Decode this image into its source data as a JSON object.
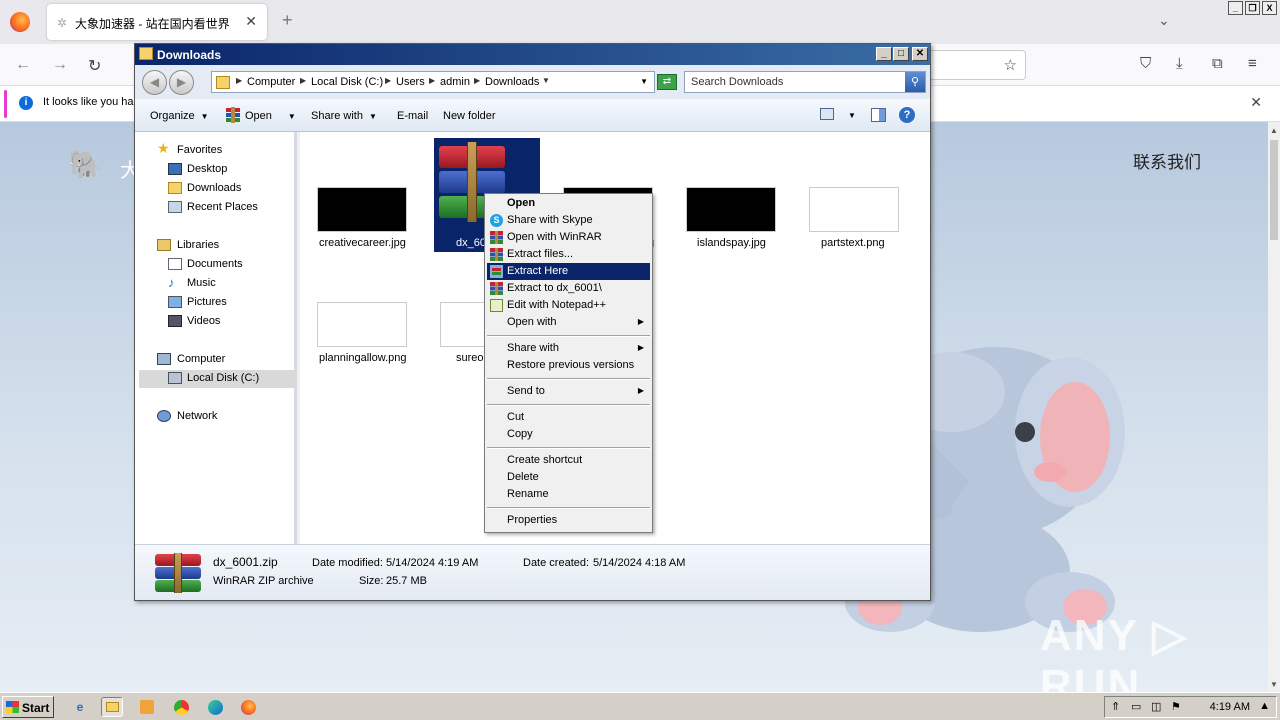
{
  "browser": {
    "tab_title": "大象加速器 - 站在国内看世界",
    "tab_close": "✕",
    "new_tab": "+",
    "tab_list": "⌄",
    "back": "←",
    "forward": "→",
    "reload": "↻",
    "notice_text": "It looks like you ha",
    "notice_close": "✕",
    "window_min": "_",
    "window_restore": "❐",
    "window_close": "X"
  },
  "webpage": {
    "brand_char": "大",
    "contact": "联系我们",
    "watermark": "ANY ▷ RUN"
  },
  "explorer": {
    "title": "Downloads",
    "breadcrumbs": [
      "Computer",
      "Local Disk (C:)",
      "Users",
      "admin",
      "Downloads"
    ],
    "search_placeholder": "Search Downloads",
    "commands": {
      "organize": "Organize",
      "open": "Open",
      "share_with": "Share with",
      "email": "E-mail",
      "new_folder": "New folder"
    },
    "nav": {
      "favorites": "Favorites",
      "desktop": "Desktop",
      "downloads": "Downloads",
      "recent_places": "Recent Places",
      "libraries": "Libraries",
      "documents": "Documents",
      "music": "Music",
      "pictures": "Pictures",
      "videos": "Videos",
      "computer": "Computer",
      "local_disk": "Local Disk (C:)",
      "network": "Network"
    },
    "files": [
      {
        "name": "creativecareer.jpg"
      },
      {
        "name": "dx_60"
      },
      {
        "name": "g"
      },
      {
        "name": "islandspay.jpg"
      },
      {
        "name": "partstext.png"
      },
      {
        "name": "planningallow.png"
      },
      {
        "name": "sureo"
      }
    ],
    "details": {
      "name": "dx_6001.zip",
      "type": "WinRAR ZIP archive",
      "modified_label": "Date modified:",
      "modified": "5/14/2024 4:19 AM",
      "created_label": "Date created:",
      "created": "5/14/2024 4:18 AM",
      "size_label": "Size:",
      "size": "25.7 MB"
    }
  },
  "context_menu": {
    "items": [
      {
        "label": "Open",
        "bold": true
      },
      {
        "label": "Share with Skype"
      },
      {
        "label": "Open with WinRAR"
      },
      {
        "label": "Extract files..."
      },
      {
        "label": "Extract Here",
        "highlighted": true
      },
      {
        "label": "Extract to dx_6001\\"
      },
      {
        "label": "Edit with Notepad++"
      },
      {
        "label": "Open with",
        "submenu": true
      },
      {
        "label": "Share with",
        "submenu": true
      },
      {
        "label": "Restore previous versions"
      },
      {
        "label": "Send to",
        "submenu": true
      },
      {
        "label": "Cut"
      },
      {
        "label": "Copy"
      },
      {
        "label": "Create shortcut"
      },
      {
        "label": "Delete"
      },
      {
        "label": "Rename"
      },
      {
        "label": "Properties"
      }
    ]
  },
  "taskbar": {
    "start": "Start",
    "clock": "4:19 AM"
  },
  "colors": {
    "selection": "#0a246a",
    "titlebar": "#0a246a",
    "taskbar": "#d4d0c8"
  }
}
